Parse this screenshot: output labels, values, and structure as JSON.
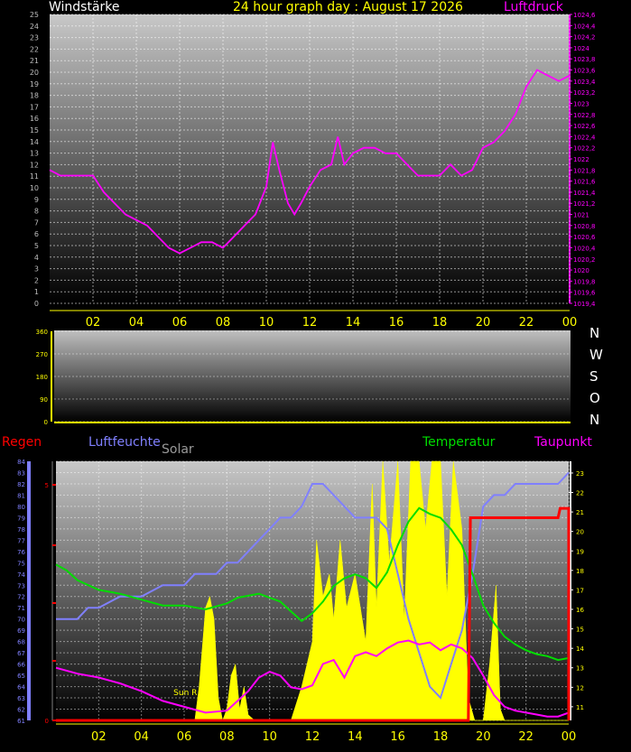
{
  "header": {
    "left_label": "Windstärke",
    "title": "24 hour graph day : August 17 2026",
    "right_label": "Luftdruck"
  },
  "direction_labels": [
    "N",
    "W",
    "S",
    "O",
    "N"
  ],
  "bottom_header": {
    "regen": "Regen",
    "luftfeuchte": "Luftfeuchte",
    "solar": "Solar",
    "temperatur": "Temperatur",
    "taupunkt": "Taupunkt"
  },
  "annotations": {
    "sun": "Sun R"
  },
  "colors": {
    "wind_axis": "#bbbbbb",
    "pressure": "#ff00ff",
    "time_axis": "#ffff00",
    "regen": "#ff0000",
    "luftfeuchte": "#8080ff",
    "solar": "#ffff00",
    "temperatur": "#00dd00",
    "taupunkt": "#ff00ff"
  },
  "chart_data": [
    {
      "type": "line",
      "x_ticks": [
        "02",
        "04",
        "06",
        "08",
        "10",
        "12",
        "14",
        "16",
        "18",
        "20",
        "22",
        "00"
      ],
      "left_axis": {
        "label": "Windstärke",
        "ylim": [
          0,
          25
        ],
        "ticks": [
          "0",
          "1",
          "2",
          "3",
          "4",
          "5",
          "6",
          "7",
          "8",
          "9",
          "10",
          "11",
          "12",
          "13",
          "14",
          "15",
          "16",
          "17",
          "18",
          "19",
          "20",
          "21",
          "22",
          "23",
          "24",
          "25"
        ]
      },
      "right_axis": {
        "label": "Luftdruck",
        "ylim": [
          1019.4,
          1024.6
        ],
        "ticks": [
          "1019,4",
          "1019,6",
          "1019,8",
          "1020",
          "1020,2",
          "1020,4",
          "1020,6",
          "1020,8",
          "1021",
          "1021,2",
          "1021,4",
          "1021,6",
          "1021,8",
          "1022",
          "1022,2",
          "1022,4",
          "1022,6",
          "1022,8",
          "1023",
          "1023,2",
          "1023,4",
          "1023,6",
          "1023,8",
          "1024",
          "1024,2",
          "1024,4",
          "1024,6"
        ]
      },
      "series": [
        {
          "name": "Luftdruck",
          "axis": "right",
          "x": [
            0,
            0.5,
            1,
            1.5,
            2,
            2.5,
            3,
            3.5,
            4,
            4.5,
            5,
            5.5,
            6,
            6.5,
            7,
            7.5,
            8,
            8.5,
            9,
            9.5,
            10,
            10.3,
            10.6,
            11,
            11.3,
            11.6,
            12,
            12.5,
            13,
            13.3,
            13.6,
            14,
            14.5,
            15,
            15.5,
            16,
            16.5,
            17,
            17.5,
            18,
            18.5,
            19,
            19.5,
            20,
            20.5,
            21,
            21.5,
            22,
            22.5,
            23,
            23.5,
            24
          ],
          "values": [
            1021.8,
            1021.7,
            1021.7,
            1021.7,
            1021.7,
            1021.4,
            1021.2,
            1021.0,
            1020.9,
            1020.8,
            1020.6,
            1020.4,
            1020.3,
            1020.4,
            1020.5,
            1020.5,
            1020.4,
            1020.6,
            1020.8,
            1021.0,
            1021.5,
            1022.3,
            1021.8,
            1021.2,
            1021.0,
            1021.2,
            1021.5,
            1021.8,
            1021.9,
            1022.4,
            1021.9,
            1022.1,
            1022.2,
            1022.2,
            1022.1,
            1022.1,
            1021.9,
            1021.7,
            1021.7,
            1021.7,
            1021.9,
            1021.7,
            1021.8,
            1022.2,
            1022.3,
            1022.5,
            1022.8,
            1023.3,
            1023.6,
            1023.5,
            1023.4,
            1023.5
          ]
        }
      ]
    },
    {
      "type": "line",
      "y_ticks": [
        "0",
        "90",
        "180",
        "270",
        "360"
      ],
      "ylim": [
        0,
        360
      ],
      "series": []
    },
    {
      "type": "area",
      "x_ticks": [
        "02",
        "04",
        "06",
        "08",
        "10",
        "12",
        "14",
        "16",
        "18",
        "20",
        "22",
        "00"
      ],
      "left_axis": {
        "ylim": [
          61,
          84
        ],
        "ticks": [
          "61",
          "62",
          "63",
          "64",
          "65",
          "66",
          "67",
          "68",
          "69",
          "70",
          "71",
          "72",
          "73",
          "74",
          "75",
          "76",
          "77",
          "78",
          "79",
          "80",
          "81",
          "82",
          "83",
          "84"
        ]
      },
      "regen_axis": {
        "ylim": [
          0,
          5
        ],
        "ticks": [
          "0",
          "5"
        ]
      },
      "right_axis": {
        "ylim": [
          10.3,
          23.6
        ],
        "ticks": [
          "11",
          "12",
          "13",
          "14",
          "15",
          "16",
          "17",
          "18",
          "19",
          "20",
          "21",
          "22",
          "23"
        ]
      },
      "series": [
        {
          "name": "Luftfeuchte",
          "axis": "left",
          "x": [
            0,
            1,
            1.5,
            2,
            3,
            3.5,
            4,
            5,
            5.5,
            6,
            6.5,
            7,
            7.5,
            8,
            8.5,
            9,
            9.5,
            10,
            10.5,
            11,
            11.5,
            12,
            12.5,
            13,
            13.5,
            14,
            14.5,
            15,
            15.5,
            16,
            16.5,
            17,
            17.5,
            18,
            18.5,
            19,
            19.5,
            20,
            20.5,
            21,
            21.5,
            22,
            22.5,
            23,
            23.5,
            24
          ],
          "values": [
            70,
            70,
            71,
            71,
            72,
            72,
            72,
            73,
            73,
            73,
            74,
            74,
            74,
            75,
            75,
            76,
            77,
            78,
            79,
            79,
            80,
            82,
            82,
            81,
            80,
            79,
            79,
            79,
            78,
            74,
            70,
            67,
            64,
            63,
            66,
            69,
            74,
            80,
            81,
            81,
            82,
            82,
            82,
            82,
            82,
            83
          ]
        },
        {
          "name": "Temperatur",
          "axis": "right",
          "x": [
            0,
            0.5,
            1,
            2,
            3,
            4,
            5,
            6,
            7,
            8,
            8.5,
            9,
            9.5,
            10,
            10.5,
            11,
            11.5,
            12,
            12.5,
            13,
            13.5,
            14,
            14.5,
            15,
            15.5,
            16,
            16.5,
            17,
            17.5,
            18,
            18.5,
            19,
            19.5,
            20,
            20.5,
            21,
            21.5,
            22,
            22.5,
            23,
            23.5,
            24
          ],
          "values": [
            18.3,
            18.0,
            17.5,
            17.0,
            16.8,
            16.5,
            16.2,
            16.2,
            16.0,
            16.3,
            16.6,
            16.7,
            16.8,
            16.6,
            16.4,
            15.9,
            15.4,
            15.8,
            16.4,
            17.2,
            17.6,
            17.8,
            17.6,
            17.1,
            17.9,
            19.3,
            20.5,
            21.2,
            20.9,
            20.7,
            20.1,
            19.3,
            17.8,
            16.2,
            15.3,
            14.6,
            14.2,
            13.9,
            13.7,
            13.6,
            13.4,
            13.5
          ]
        },
        {
          "name": "Taupunkt",
          "axis": "right",
          "x": [
            0,
            1,
            2,
            3,
            4,
            5,
            6,
            7,
            8,
            8.5,
            9,
            9.5,
            10,
            10.5,
            11,
            11.5,
            12,
            12.5,
            13,
            13.5,
            14,
            14.5,
            15,
            15.5,
            16,
            16.5,
            17,
            17.5,
            18,
            18.5,
            19,
            19.5,
            20,
            20.5,
            21,
            21.5,
            22,
            22.5,
            23,
            23.5,
            24
          ],
          "values": [
            13.0,
            12.7,
            12.5,
            12.2,
            11.8,
            11.3,
            11.0,
            10.7,
            10.8,
            11.3,
            11.8,
            12.5,
            12.8,
            12.6,
            12.0,
            11.9,
            12.1,
            13.2,
            13.4,
            12.5,
            13.6,
            13.8,
            13.6,
            14.0,
            14.3,
            14.4,
            14.2,
            14.3,
            13.9,
            14.2,
            14.0,
            13.5,
            12.6,
            11.6,
            11.0,
            10.8,
            10.7,
            10.6,
            10.5,
            10.5,
            10.7
          ]
        },
        {
          "name": "Solar",
          "axis": "left",
          "type": "area",
          "x": [
            0,
            6.3,
            6.5,
            6.7,
            7,
            7.2,
            7.4,
            7.6,
            7.8,
            8,
            8.2,
            8.4,
            8.6,
            8.8,
            9,
            9.3,
            9.6,
            10,
            10.5,
            11,
            11.5,
            12,
            12.2,
            12.5,
            12.8,
            13,
            13.3,
            13.6,
            14,
            14.5,
            14.8,
            15,
            15.3,
            15.6,
            16,
            16.3,
            16.6,
            17,
            17.3,
            17.6,
            18,
            18.3,
            18.6,
            19,
            19.3,
            19.6,
            20,
            20.3,
            20.6,
            20.8,
            21,
            24
          ],
          "values": [
            61,
            61,
            61,
            64,
            71,
            72,
            70,
            63,
            61,
            62,
            65,
            66,
            62,
            64,
            61.5,
            61,
            61,
            61,
            61,
            61,
            64,
            68,
            77,
            72,
            74,
            70,
            77,
            71,
            74,
            68,
            82,
            71,
            84,
            75,
            84,
            70,
            84,
            84,
            78,
            84,
            84,
            72,
            84,
            78,
            63,
            61,
            61,
            66,
            73,
            62,
            61,
            61
          ]
        },
        {
          "name": "Regen",
          "axis": "regen",
          "x": [
            0,
            19.3,
            19.4,
            23.5,
            23.6,
            24
          ],
          "values": [
            0,
            0,
            4.3,
            4.3,
            4.5,
            4.5
          ]
        }
      ]
    }
  ]
}
